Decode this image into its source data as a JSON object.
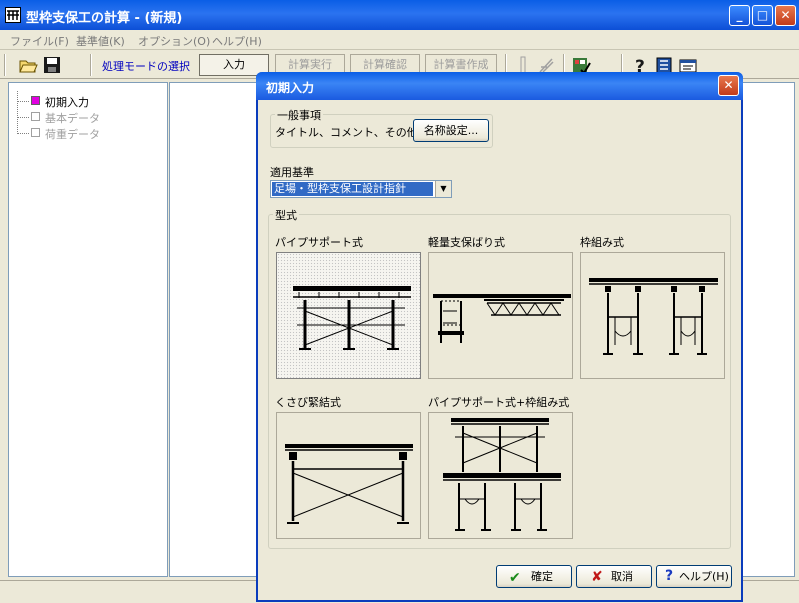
{
  "window": {
    "title": "型枠支保工の計算 - (新規)"
  },
  "menu": [
    "ファイル(F)",
    "基準値(K)",
    "オプション(O)",
    "ヘルプ(H)"
  ],
  "toolbar": {
    "mode_label": "処理モードの選択",
    "buttons": [
      "入力",
      "計算実行",
      "計算確認",
      "計算書作成"
    ]
  },
  "tree": {
    "items": [
      {
        "label": "初期入力",
        "active": true
      },
      {
        "label": "基本データ",
        "active": false
      },
      {
        "label": "荷重データ",
        "active": false
      }
    ]
  },
  "dialog": {
    "title": "初期入力",
    "general": {
      "group_label": "一般事項",
      "field_label": "タイトル、コメント、その他:",
      "name_button": "名称設定..."
    },
    "standard": {
      "label": "適用基準",
      "selected": "足場・型枠支保工設計指針"
    },
    "types": {
      "group_label": "型式",
      "items": [
        "パイプサポート式",
        "軽量支保ばり式",
        "枠組み式",
        "くさび緊結式",
        "パイプサポート式+枠組み式"
      ],
      "selected_index": 0
    },
    "buttons": {
      "ok": "確定",
      "cancel": "取消",
      "help": "ヘルプ(H)"
    }
  },
  "colors": {
    "titlebar": "#0a5ee6",
    "active_tree_box": "#e000e0",
    "selection": "#316ac5"
  }
}
